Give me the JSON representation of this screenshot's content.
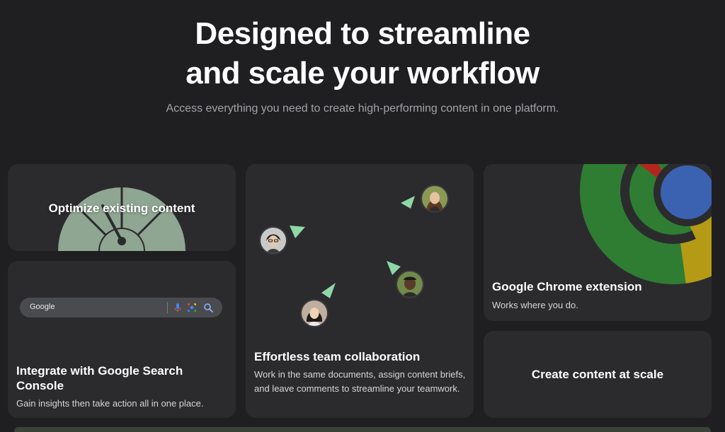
{
  "hero": {
    "title_line1": "Designed to streamline",
    "title_line2": "and scale your workflow",
    "subtitle": "Access everything you need to create high-performing content in one platform."
  },
  "cards": {
    "optimize": {
      "title": "Optimize existing content"
    },
    "search_console": {
      "title": "Integrate with Google Search Console",
      "description": "Gain insights then take action all in one place.",
      "search_placeholder": "Google"
    },
    "collaboration": {
      "title": "Effortless team collaboration",
      "description": "Work in the same documents, assign content briefs, and leave comments to streamline your teamwork."
    },
    "chrome": {
      "title": "Google Chrome extension",
      "description": "Works where you do."
    },
    "scale": {
      "title": "Create content at scale"
    }
  },
  "colors": {
    "background": "#1f1f21",
    "card": "#2b2b2e",
    "gauge": "#8fa692",
    "cursor": "#8ed7a6",
    "chrome_green": "#2e7d32",
    "chrome_red": "#b3261e",
    "chrome_yellow": "#b59a16",
    "chrome_blue": "#3a62b0"
  },
  "icons": [
    "microphone-icon",
    "google-lens-icon",
    "search-icon",
    "cursor-arrow-icon",
    "avatar"
  ]
}
